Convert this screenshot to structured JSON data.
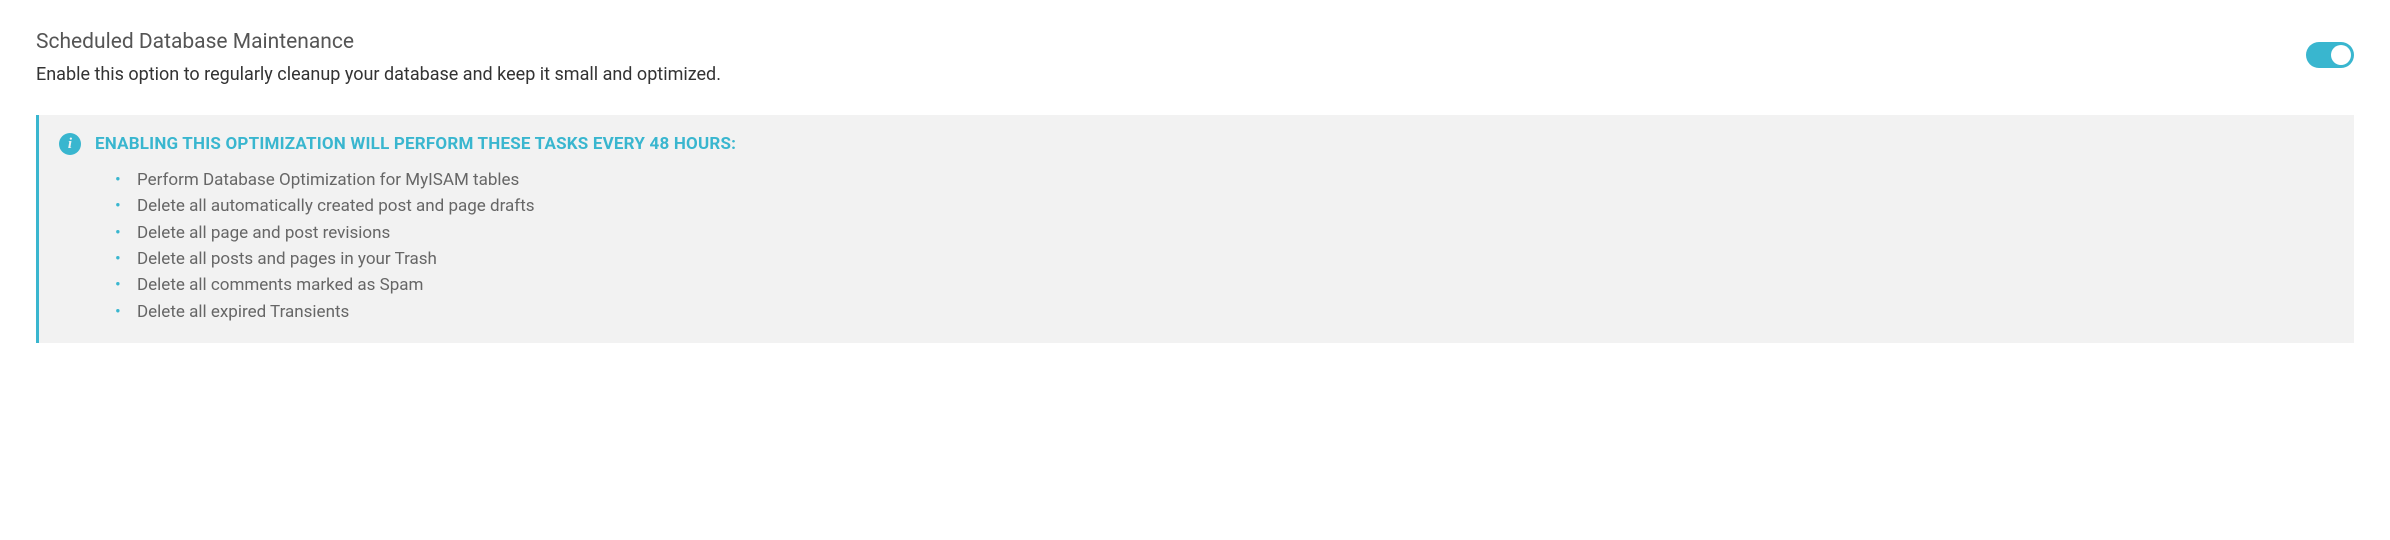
{
  "header": {
    "title": "Scheduled Database Maintenance",
    "description": "Enable this option to regularly cleanup your database and keep it small and optimized."
  },
  "toggle": {
    "state": "on"
  },
  "info": {
    "title": "ENABLING THIS OPTIMIZATION WILL PERFORM THESE TASKS EVERY 48 HOURS:",
    "tasks": [
      "Perform Database Optimization for MyISAM tables",
      "Delete all automatically created post and page drafts",
      "Delete all page and post revisions",
      "Delete all posts and pages in your Trash",
      "Delete all comments marked as Spam",
      "Delete all expired Transients"
    ]
  }
}
